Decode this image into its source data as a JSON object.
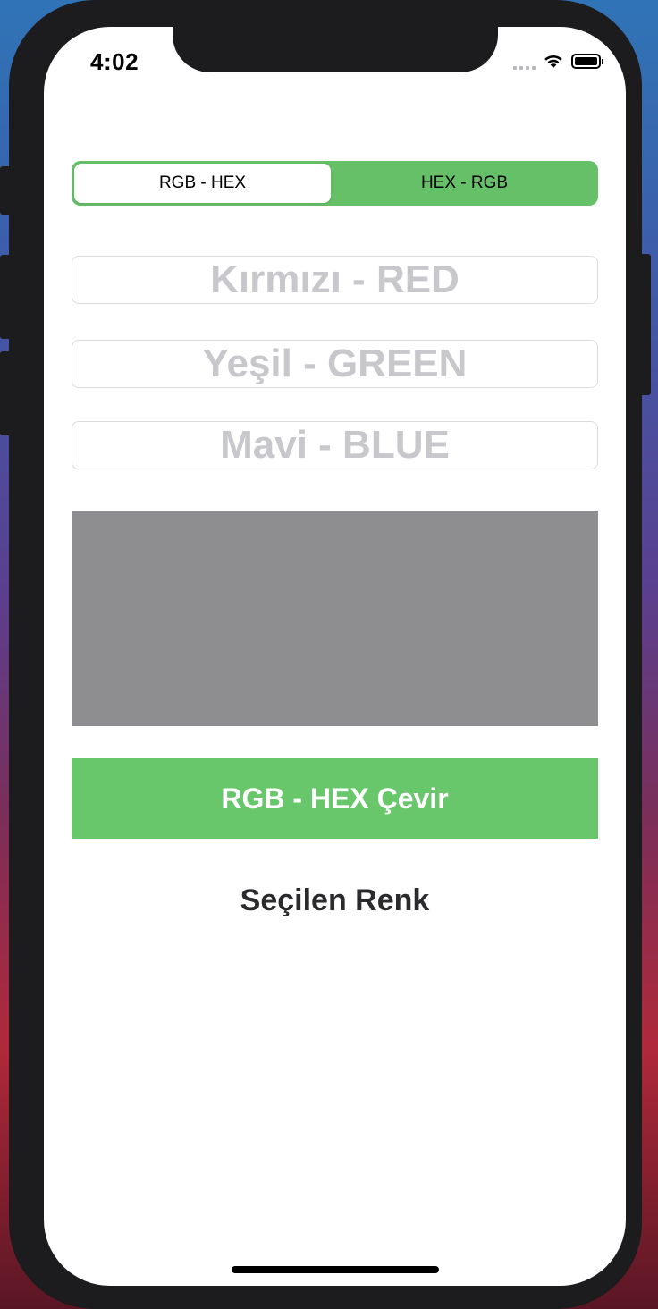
{
  "status_bar": {
    "time": "4:02",
    "icons": [
      "signal-icon",
      "wifi-icon",
      "battery-icon"
    ]
  },
  "segmented_control": {
    "options": [
      "RGB -  HEX",
      "HEX - RGB"
    ],
    "selected_index": 0,
    "accent_color": "#66c068"
  },
  "inputs": {
    "red": {
      "placeholder": "Kırmızı - RED",
      "value": ""
    },
    "green": {
      "placeholder": "Yeşil - GREEN",
      "value": ""
    },
    "blue": {
      "placeholder": "Mavi - BLUE",
      "value": ""
    }
  },
  "preview": {
    "color": "#8e8e90"
  },
  "convert_button": {
    "label": "RGB - HEX Çevir",
    "color": "#68c76a"
  },
  "result": {
    "label": "Seçilen Renk"
  }
}
